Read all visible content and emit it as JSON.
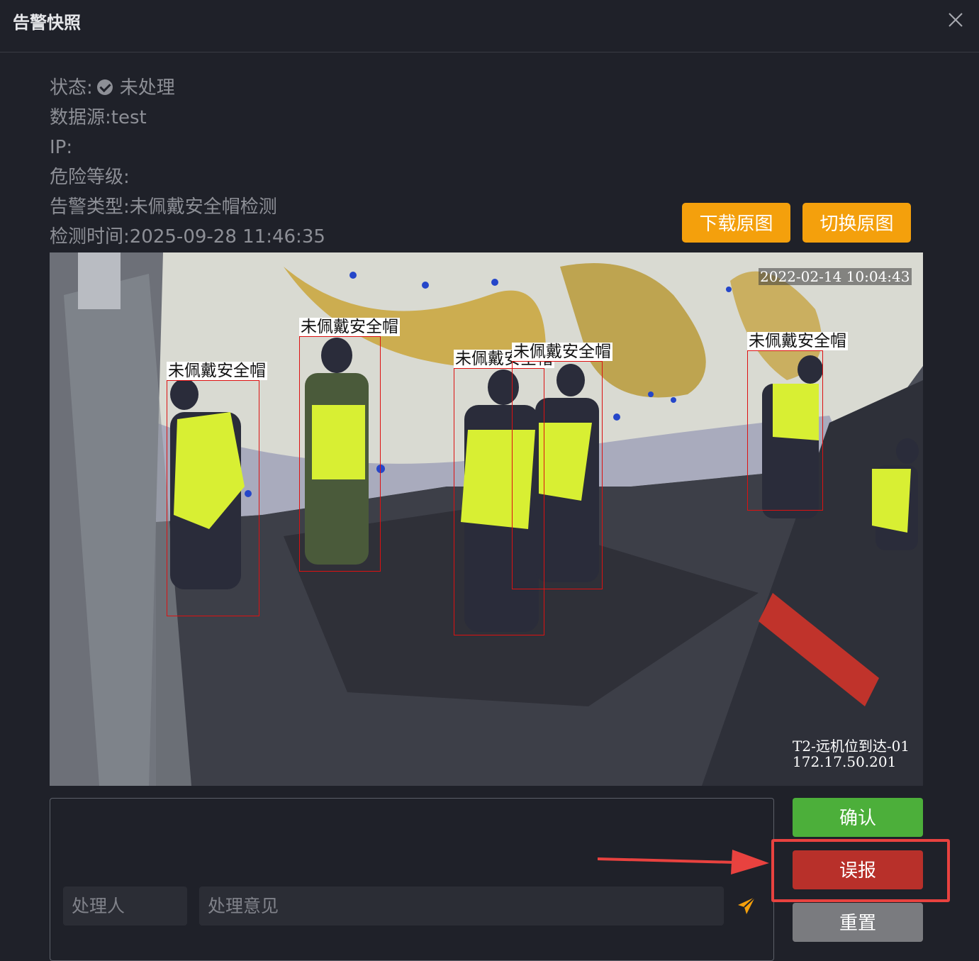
{
  "dialog": {
    "title": "告警快照"
  },
  "info": {
    "status_label": "状态:",
    "status_value": "未处理",
    "source_label": "数据源:",
    "source_value": "test",
    "ip_label": "IP:",
    "ip_value": "",
    "risk_label": "危险等级:",
    "risk_value": "",
    "type_label": "告警类型:",
    "type_value": "未佩戴安全帽检测",
    "time_label": "检测时间:",
    "time_value": "2025-09-28 11:46:35"
  },
  "toolbar": {
    "download_label": "下载原图",
    "switch_label": "切换原图"
  },
  "snapshot": {
    "timestamp": "2022-02-14 10:04:43",
    "camera_name": "T2-远机位到达-01",
    "camera_ip": "172.17.50.201",
    "detections": [
      "未佩戴安全帽",
      "未佩戴安全帽",
      "未佩戴安全帽",
      "未佩戴安全帽",
      "未佩戴安全帽"
    ],
    "box_color": "#dd1111"
  },
  "form": {
    "handler_placeholder": "处理人",
    "opinion_placeholder": "处理意见"
  },
  "actions": {
    "confirm_label": "确认",
    "false_report_label": "误报",
    "reset_label": "重置"
  },
  "colors": {
    "orange": "#f4a00c",
    "green": "#4caf3a",
    "red": "#b8302a",
    "gray": "#7a7b7f",
    "highlight": "#e8423f"
  }
}
